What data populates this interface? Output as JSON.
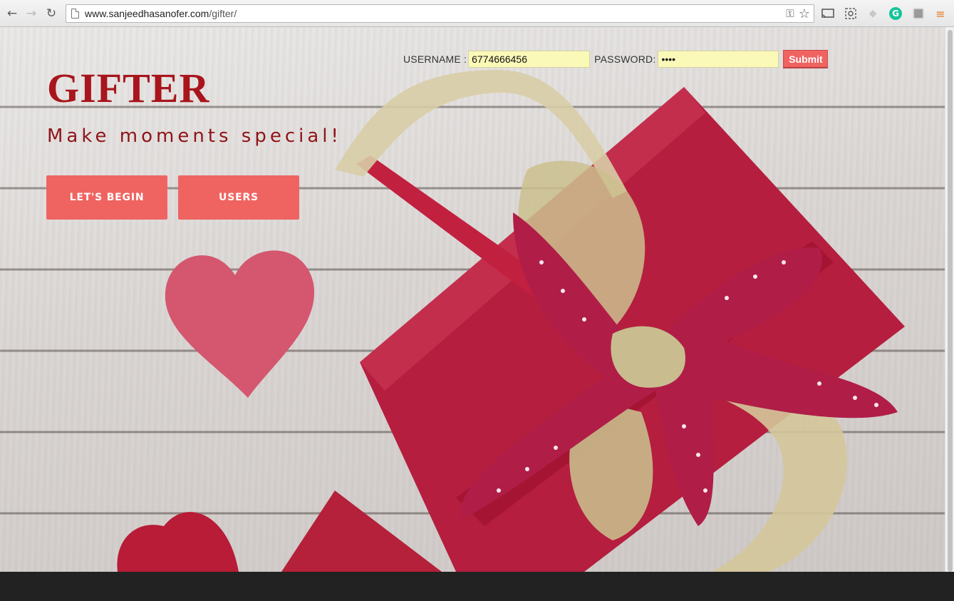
{
  "browser": {
    "url_host": "www.sanjeedhasanofer.com",
    "url_path": "/gifter/",
    "icons": [
      "back-icon",
      "forward-icon",
      "reload-icon",
      "page-icon",
      "key-icon",
      "bookmark-star-icon",
      "cast-icon",
      "screenshot-icon",
      "extension-icon",
      "grammarly-icon",
      "extension-gray-icon",
      "chrome-menu-icon"
    ],
    "grammarly_letter": "G"
  },
  "login": {
    "username_label": "USERNAME :",
    "username_value": "6774666456",
    "password_label": "PASSWORD:",
    "password_value": "••••",
    "submit_label": "Submit"
  },
  "hero": {
    "brand": "GIFTER",
    "tagline": "Make moments special!",
    "buttons": {
      "begin_label": "LET'S BEGIN",
      "users_label": "USERS"
    }
  },
  "colors": {
    "brand": "#a8151c",
    "button": "#ef6461",
    "input_autofill": "#fbf9b8",
    "footer": "#222222"
  }
}
